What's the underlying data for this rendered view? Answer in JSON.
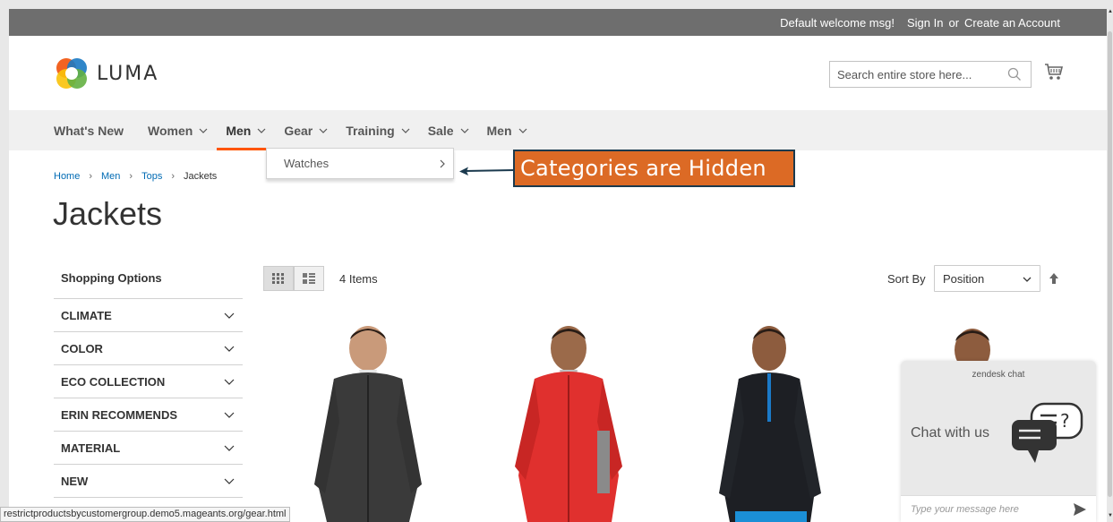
{
  "topbar": {
    "welcome": "Default welcome msg!",
    "sign_in": "Sign In",
    "or": "or",
    "create_account": "Create an Account"
  },
  "header": {
    "logo_text": "LUMA",
    "search_placeholder": "Search entire store here..."
  },
  "nav": {
    "items": [
      {
        "label": "What's New",
        "has_chevron": false
      },
      {
        "label": "Women",
        "has_chevron": true
      },
      {
        "label": "Men",
        "has_chevron": true,
        "active": true
      },
      {
        "label": "Gear",
        "has_chevron": true
      },
      {
        "label": "Training",
        "has_chevron": true
      },
      {
        "label": "Sale",
        "has_chevron": true
      },
      {
        "label": "Men",
        "has_chevron": true
      }
    ]
  },
  "dropdown": {
    "items": [
      "Watches"
    ]
  },
  "annotation": {
    "text": "Categories are Hidden"
  },
  "breadcrumb": [
    "Home",
    "Men",
    "Tops",
    "Jackets"
  ],
  "page_title": "Jackets",
  "sidebar": {
    "title": "Shopping Options",
    "filters": [
      "CLIMATE",
      "COLOR",
      "ECO COLLECTION",
      "ERIN RECOMMENDS",
      "MATERIAL",
      "NEW"
    ]
  },
  "toolbar": {
    "items_count": "4 Items",
    "sort_label": "Sort By",
    "sort_value": "Position"
  },
  "chat": {
    "brand": "zendesk chat",
    "title": "Chat with us",
    "input_placeholder": "Type your message here"
  },
  "status_url": "restrictproductsbycustomergroup.demo5.mageants.org/gear.html",
  "colors": {
    "accent_orange": "#ff5501",
    "annotation_bg": "#dc6a25",
    "annotation_border": "#1b3a4e",
    "link_blue": "#006bb4",
    "topbar_bg": "#6e6e6e"
  }
}
